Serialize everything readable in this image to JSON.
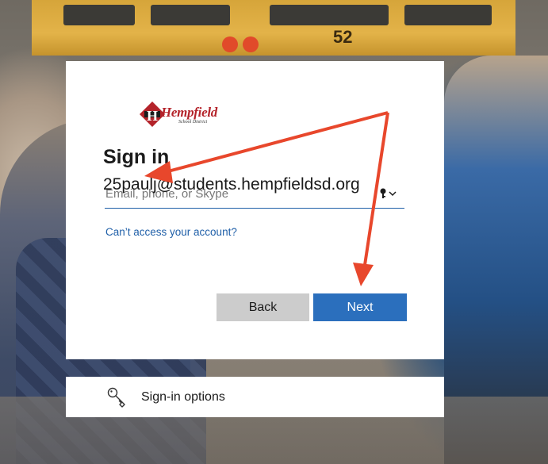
{
  "logo": {
    "name": "Hempfield",
    "subtitle": "School District"
  },
  "signin": {
    "title": "Sign in",
    "email_value": "25paulj@students.hempfieldsd.org",
    "email_placeholder": "Email, phone, or Skype",
    "cant_access_link": "Can’t access your account?",
    "back_button": "Back",
    "next_button": "Next"
  },
  "options": {
    "label": "Sign-in options"
  },
  "background": {
    "bus_number": "52"
  },
  "colors": {
    "accent": "#2b6fbd",
    "link": "#1f5fa8",
    "annotation_arrow": "#e8472c",
    "back_button": "#cccccc"
  },
  "icons": {
    "key_dropdown": "key-chevron-icon",
    "sign_in_options": "key-icon"
  }
}
